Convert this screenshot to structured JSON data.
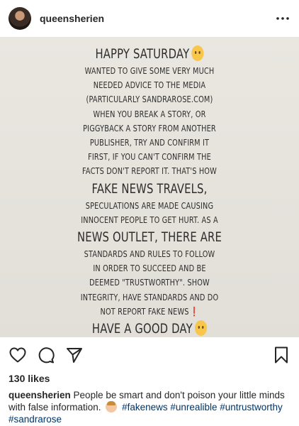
{
  "post": {
    "username": "queensherien",
    "likes": "130 likes"
  },
  "story": {
    "lines": [
      "HAPPY SATURDAY",
      "WANTED TO GIVE SOME VERY MUCH",
      "NEEDED ADVICE TO THE MEDIA",
      "(PARTICULARLY SANDRAROSE.COM)",
      "WHEN YOU BREAK A STORY, OR",
      "PIGGYBACK A STORY FROM ANOTHER",
      "PUBLISHER, TRY AND CONFIRM IT",
      "FIRST, IF YOU CAN'T CONFIRM THE",
      "FACTS DON'T REPORT IT. THAT'S HOW",
      "FAKE NEWS TRAVELS,",
      "SPECULATIONS ARE MADE CAUSING",
      "INNOCENT PEOPLE TO GET HURT. AS A",
      "NEWS OUTLET, THERE ARE",
      "STANDARDS AND RULES TO FOLLOW",
      "IN ORDER TO SUCCEED AND BE",
      "DEEMED \"TRUSTWORTHY\". SHOW",
      "INTEGRITY, HAVE STANDARDS AND DO",
      "NOT REPORT FAKE NEWS",
      "HAVE A GOOD DAY"
    ],
    "exclamation": "❗"
  },
  "caption": {
    "username": "queensherien",
    "text": "People be smart and don't poison your little minds with false information.",
    "hashtags": [
      "#fakenews",
      "#unrealible",
      "#untrustworthy",
      "#sandrarose"
    ]
  }
}
